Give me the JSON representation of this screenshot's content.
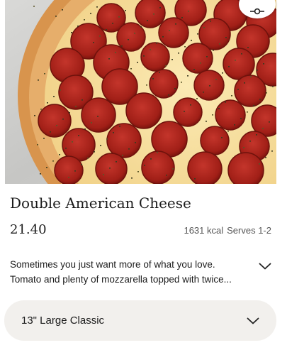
{
  "product": {
    "image_alt": "Pepperoni pizza",
    "title": "Double American Cheese",
    "price": "21.40",
    "calories": "1631 kcal",
    "serves": "Serves 1-2",
    "description_line1": "Sometimes you just want more of what you love.",
    "description_line2": "Tomato and plenty of mozzarella topped with twice..."
  },
  "size_selector": {
    "selected": "13\" Large Classic"
  },
  "icons": {
    "filter": "filter-icon",
    "expand_description": "chevron-down-icon",
    "size_dropdown": "chevron-down-icon"
  },
  "colors": {
    "crust": "#e0a15c",
    "cheese": "#f6e3a6",
    "pepperoni": "#b3261e",
    "select_bg": "#f2f0ed"
  }
}
